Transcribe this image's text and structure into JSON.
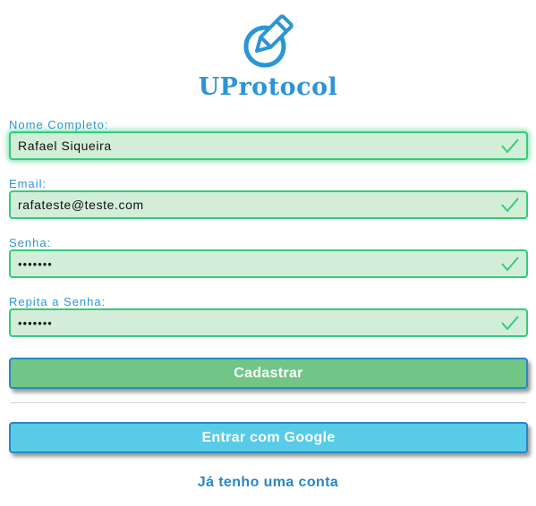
{
  "brand": {
    "name": "UProtocol",
    "icon": "pencil-circle-icon",
    "color": "#2b95d6"
  },
  "form": {
    "fields": [
      {
        "label": "Nome Completo:",
        "value": "Rafael Siqueira",
        "valid": true
      },
      {
        "label": "Email:",
        "value": "rafateste@teste.com",
        "valid": true
      },
      {
        "label": "Senha:",
        "value": "•••••••",
        "valid": true
      },
      {
        "label": "Repita a Senha:",
        "value": "•••••••",
        "valid": true
      }
    ],
    "submit_label": "Cadastrar",
    "google_label": "Entrar com Google",
    "login_link": "Já tenho uma conta"
  },
  "colors": {
    "valid_border": "#33cc7a",
    "valid_bg": "#d2eed8",
    "submit": "#71c685",
    "google": "#57cbe8",
    "link": "#2b86c5"
  }
}
